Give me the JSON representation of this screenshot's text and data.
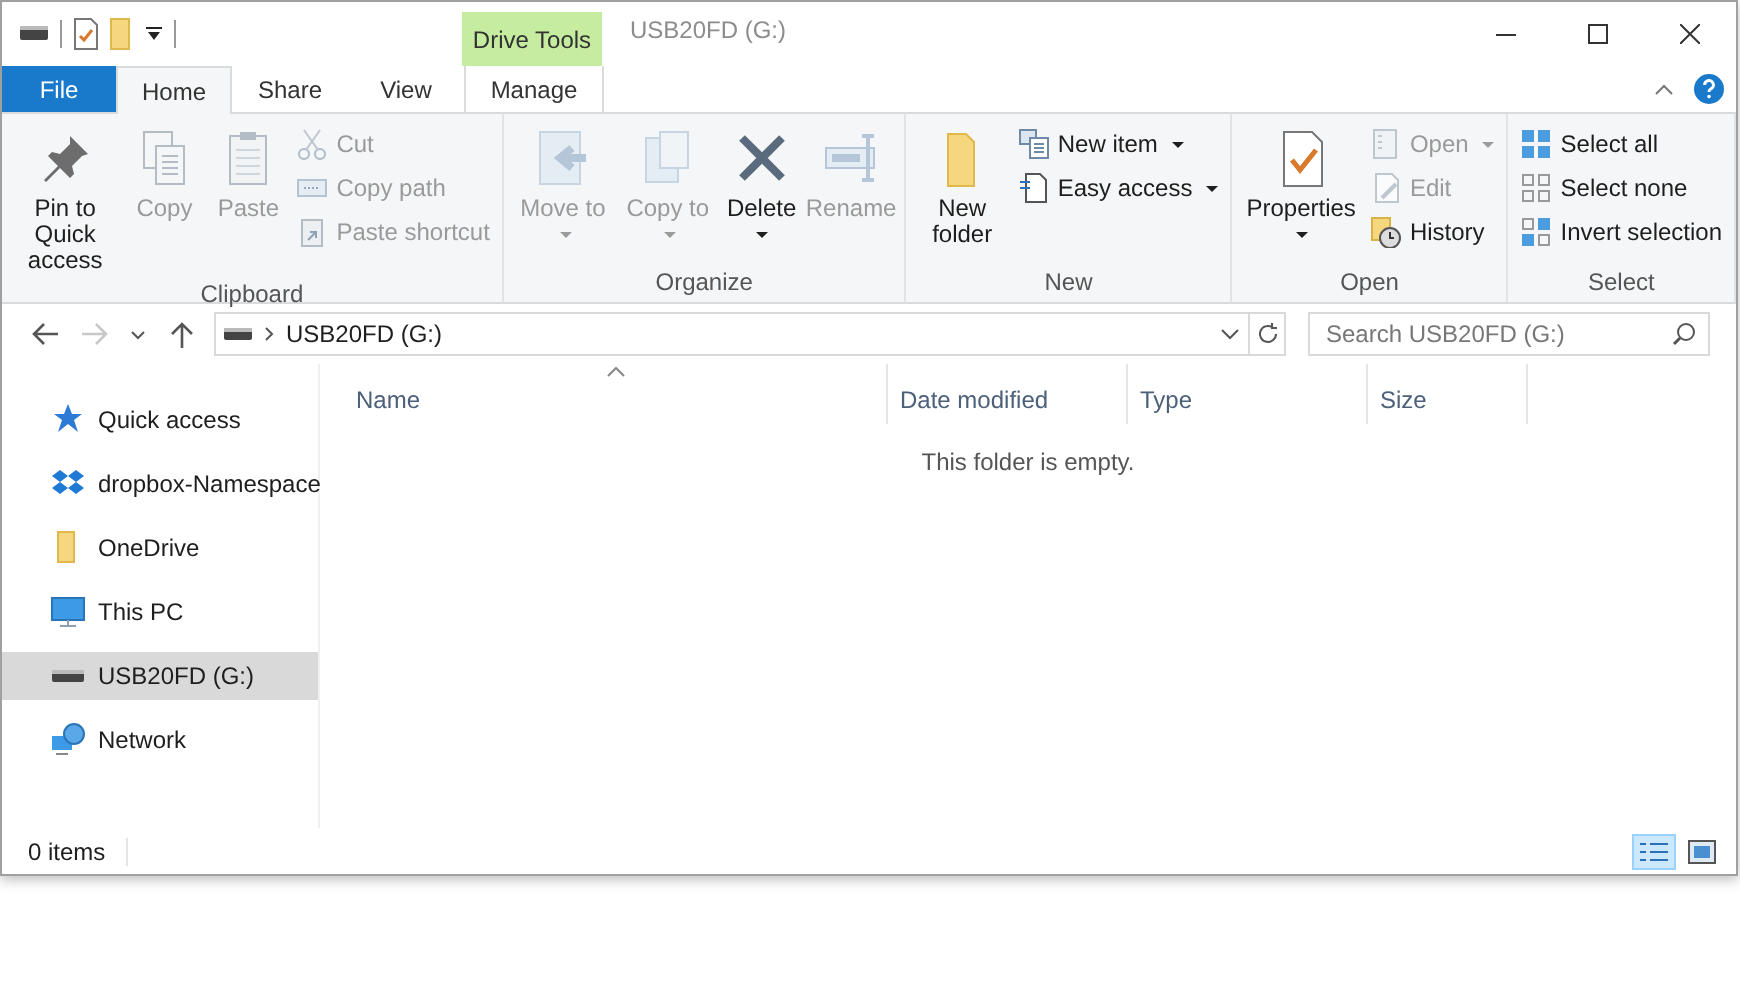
{
  "window": {
    "title": "USB20FD (G:)",
    "contextual_label": "Drive Tools"
  },
  "tabs": [
    {
      "label": "File",
      "kind": "file",
      "selected": false
    },
    {
      "label": "Home",
      "kind": "tab",
      "selected": true
    },
    {
      "label": "Share",
      "kind": "tab",
      "selected": false
    },
    {
      "label": "View",
      "kind": "tab",
      "selected": false
    },
    {
      "label": "Manage",
      "kind": "contextual",
      "selected": false
    }
  ],
  "ribbon": {
    "groups": [
      {
        "label": "Clipboard",
        "large": [
          {
            "label": "Pin to Quick access",
            "disabled": false,
            "kind": "plain"
          },
          {
            "label": "Copy",
            "disabled": true,
            "kind": "plain"
          },
          {
            "label": "Paste",
            "disabled": true,
            "kind": "plain"
          }
        ],
        "small": [
          {
            "label": "Cut",
            "disabled": true,
            "dropdown": false
          },
          {
            "label": "Copy path",
            "disabled": true,
            "dropdown": false
          },
          {
            "label": "Paste shortcut",
            "disabled": true,
            "dropdown": false
          }
        ]
      },
      {
        "label": "Organize",
        "large": [
          {
            "label": "Move to",
            "disabled": true,
            "kind": "menu"
          },
          {
            "label": "Copy to",
            "disabled": true,
            "kind": "menu"
          },
          {
            "label": "Delete",
            "disabled": false,
            "kind": "split"
          },
          {
            "label": "Rename",
            "disabled": true,
            "kind": "plain"
          }
        ]
      },
      {
        "label": "New",
        "large": [
          {
            "label": "New folder",
            "disabled": false,
            "kind": "plain"
          }
        ],
        "small": [
          {
            "label": "New item",
            "disabled": false,
            "dropdown": true
          },
          {
            "label": "Easy access",
            "disabled": false,
            "dropdown": true
          }
        ]
      },
      {
        "label": "Open",
        "large": [
          {
            "label": "Properties",
            "disabled": false,
            "kind": "split"
          }
        ],
        "small": [
          {
            "label": "Open",
            "disabled": true,
            "dropdown": true
          },
          {
            "label": "Edit",
            "disabled": true,
            "dropdown": false
          },
          {
            "label": "History",
            "disabled": false,
            "dropdown": false
          }
        ]
      },
      {
        "label": "Select",
        "small": [
          {
            "label": "Select all",
            "disabled": false,
            "dropdown": false
          },
          {
            "label": "Select none",
            "disabled": false,
            "dropdown": false
          },
          {
            "label": "Invert selection",
            "disabled": false,
            "dropdown": false
          }
        ]
      }
    ]
  },
  "navigation": {
    "back_disabled": false,
    "forward_disabled": true,
    "address": "USB20FD (G:)",
    "search": {
      "placeholder": "Search USB20FD (G:)"
    }
  },
  "sidebar": {
    "items": [
      {
        "label": "Quick access",
        "selected": false
      },
      {
        "label": "dropbox-Namespace",
        "selected": false
      },
      {
        "label": "OneDrive",
        "selected": false
      },
      {
        "label": "This PC",
        "selected": false
      },
      {
        "label": "USB20FD (G:)",
        "selected": true
      },
      {
        "label": "Network",
        "selected": false
      }
    ]
  },
  "file_list": {
    "columns": [
      {
        "label": "Name",
        "sorted": true
      },
      {
        "label": "Date modified",
        "sorted": false
      },
      {
        "label": "Type",
        "sorted": false
      },
      {
        "label": "Size",
        "sorted": false
      }
    ],
    "empty_message": "This folder is empty."
  },
  "status_bar": {
    "count": "0 items",
    "views": [
      {
        "kind": "details",
        "selected": true
      },
      {
        "kind": "large-icons",
        "selected": false
      }
    ]
  }
}
